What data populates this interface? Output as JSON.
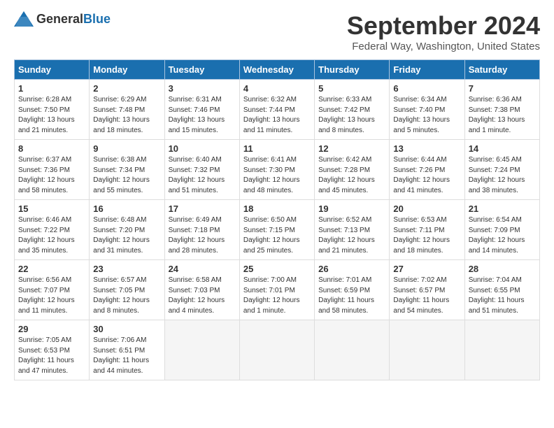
{
  "header": {
    "logo_general": "General",
    "logo_blue": "Blue",
    "main_title": "September 2024",
    "subtitle": "Federal Way, Washington, United States"
  },
  "calendar": {
    "days_of_week": [
      "Sunday",
      "Monday",
      "Tuesday",
      "Wednesday",
      "Thursday",
      "Friday",
      "Saturday"
    ],
    "weeks": [
      [
        {
          "day": "1",
          "sunrise": "Sunrise: 6:28 AM",
          "sunset": "Sunset: 7:50 PM",
          "daylight": "Daylight: 13 hours and 21 minutes."
        },
        {
          "day": "2",
          "sunrise": "Sunrise: 6:29 AM",
          "sunset": "Sunset: 7:48 PM",
          "daylight": "Daylight: 13 hours and 18 minutes."
        },
        {
          "day": "3",
          "sunrise": "Sunrise: 6:31 AM",
          "sunset": "Sunset: 7:46 PM",
          "daylight": "Daylight: 13 hours and 15 minutes."
        },
        {
          "day": "4",
          "sunrise": "Sunrise: 6:32 AM",
          "sunset": "Sunset: 7:44 PM",
          "daylight": "Daylight: 13 hours and 11 minutes."
        },
        {
          "day": "5",
          "sunrise": "Sunrise: 6:33 AM",
          "sunset": "Sunset: 7:42 PM",
          "daylight": "Daylight: 13 hours and 8 minutes."
        },
        {
          "day": "6",
          "sunrise": "Sunrise: 6:34 AM",
          "sunset": "Sunset: 7:40 PM",
          "daylight": "Daylight: 13 hours and 5 minutes."
        },
        {
          "day": "7",
          "sunrise": "Sunrise: 6:36 AM",
          "sunset": "Sunset: 7:38 PM",
          "daylight": "Daylight: 13 hours and 1 minute."
        }
      ],
      [
        {
          "day": "8",
          "sunrise": "Sunrise: 6:37 AM",
          "sunset": "Sunset: 7:36 PM",
          "daylight": "Daylight: 12 hours and 58 minutes."
        },
        {
          "day": "9",
          "sunrise": "Sunrise: 6:38 AM",
          "sunset": "Sunset: 7:34 PM",
          "daylight": "Daylight: 12 hours and 55 minutes."
        },
        {
          "day": "10",
          "sunrise": "Sunrise: 6:40 AM",
          "sunset": "Sunset: 7:32 PM",
          "daylight": "Daylight: 12 hours and 51 minutes."
        },
        {
          "day": "11",
          "sunrise": "Sunrise: 6:41 AM",
          "sunset": "Sunset: 7:30 PM",
          "daylight": "Daylight: 12 hours and 48 minutes."
        },
        {
          "day": "12",
          "sunrise": "Sunrise: 6:42 AM",
          "sunset": "Sunset: 7:28 PM",
          "daylight": "Daylight: 12 hours and 45 minutes."
        },
        {
          "day": "13",
          "sunrise": "Sunrise: 6:44 AM",
          "sunset": "Sunset: 7:26 PM",
          "daylight": "Daylight: 12 hours and 41 minutes."
        },
        {
          "day": "14",
          "sunrise": "Sunrise: 6:45 AM",
          "sunset": "Sunset: 7:24 PM",
          "daylight": "Daylight: 12 hours and 38 minutes."
        }
      ],
      [
        {
          "day": "15",
          "sunrise": "Sunrise: 6:46 AM",
          "sunset": "Sunset: 7:22 PM",
          "daylight": "Daylight: 12 hours and 35 minutes."
        },
        {
          "day": "16",
          "sunrise": "Sunrise: 6:48 AM",
          "sunset": "Sunset: 7:20 PM",
          "daylight": "Daylight: 12 hours and 31 minutes."
        },
        {
          "day": "17",
          "sunrise": "Sunrise: 6:49 AM",
          "sunset": "Sunset: 7:18 PM",
          "daylight": "Daylight: 12 hours and 28 minutes."
        },
        {
          "day": "18",
          "sunrise": "Sunrise: 6:50 AM",
          "sunset": "Sunset: 7:15 PM",
          "daylight": "Daylight: 12 hours and 25 minutes."
        },
        {
          "day": "19",
          "sunrise": "Sunrise: 6:52 AM",
          "sunset": "Sunset: 7:13 PM",
          "daylight": "Daylight: 12 hours and 21 minutes."
        },
        {
          "day": "20",
          "sunrise": "Sunrise: 6:53 AM",
          "sunset": "Sunset: 7:11 PM",
          "daylight": "Daylight: 12 hours and 18 minutes."
        },
        {
          "day": "21",
          "sunrise": "Sunrise: 6:54 AM",
          "sunset": "Sunset: 7:09 PM",
          "daylight": "Daylight: 12 hours and 14 minutes."
        }
      ],
      [
        {
          "day": "22",
          "sunrise": "Sunrise: 6:56 AM",
          "sunset": "Sunset: 7:07 PM",
          "daylight": "Daylight: 12 hours and 11 minutes."
        },
        {
          "day": "23",
          "sunrise": "Sunrise: 6:57 AM",
          "sunset": "Sunset: 7:05 PM",
          "daylight": "Daylight: 12 hours and 8 minutes."
        },
        {
          "day": "24",
          "sunrise": "Sunrise: 6:58 AM",
          "sunset": "Sunset: 7:03 PM",
          "daylight": "Daylight: 12 hours and 4 minutes."
        },
        {
          "day": "25",
          "sunrise": "Sunrise: 7:00 AM",
          "sunset": "Sunset: 7:01 PM",
          "daylight": "Daylight: 12 hours and 1 minute."
        },
        {
          "day": "26",
          "sunrise": "Sunrise: 7:01 AM",
          "sunset": "Sunset: 6:59 PM",
          "daylight": "Daylight: 11 hours and 58 minutes."
        },
        {
          "day": "27",
          "sunrise": "Sunrise: 7:02 AM",
          "sunset": "Sunset: 6:57 PM",
          "daylight": "Daylight: 11 hours and 54 minutes."
        },
        {
          "day": "28",
          "sunrise": "Sunrise: 7:04 AM",
          "sunset": "Sunset: 6:55 PM",
          "daylight": "Daylight: 11 hours and 51 minutes."
        }
      ],
      [
        {
          "day": "29",
          "sunrise": "Sunrise: 7:05 AM",
          "sunset": "Sunset: 6:53 PM",
          "daylight": "Daylight: 11 hours and 47 minutes."
        },
        {
          "day": "30",
          "sunrise": "Sunrise: 7:06 AM",
          "sunset": "Sunset: 6:51 PM",
          "daylight": "Daylight: 11 hours and 44 minutes."
        },
        {
          "day": "",
          "sunrise": "",
          "sunset": "",
          "daylight": ""
        },
        {
          "day": "",
          "sunrise": "",
          "sunset": "",
          "daylight": ""
        },
        {
          "day": "",
          "sunrise": "",
          "sunset": "",
          "daylight": ""
        },
        {
          "day": "",
          "sunrise": "",
          "sunset": "",
          "daylight": ""
        },
        {
          "day": "",
          "sunrise": "",
          "sunset": "",
          "daylight": ""
        }
      ]
    ]
  }
}
